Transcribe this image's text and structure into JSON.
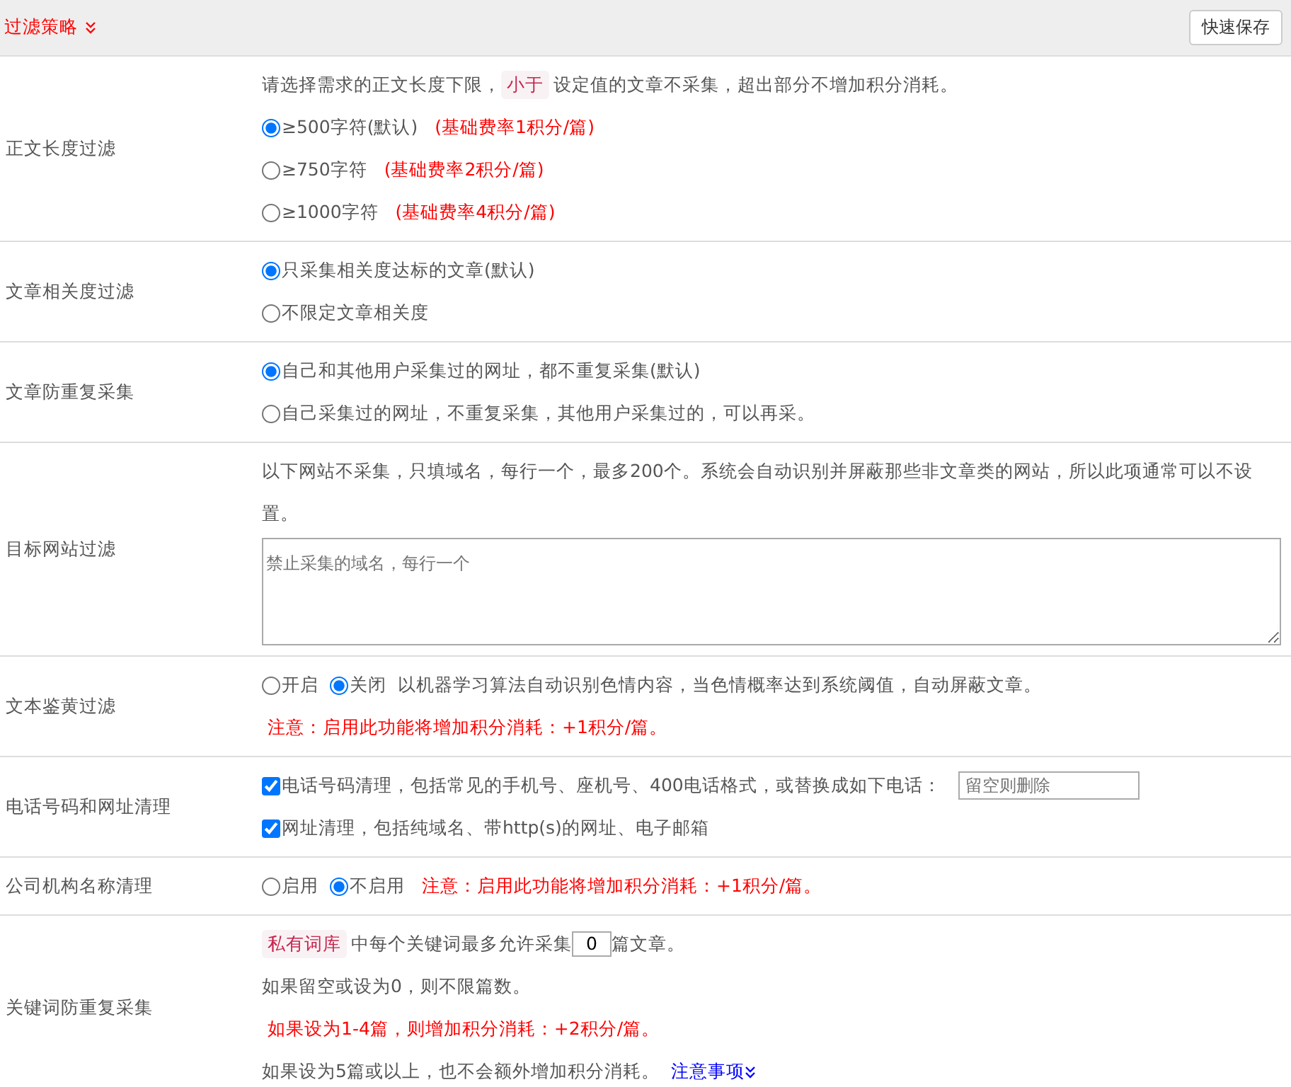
{
  "header": {
    "title": "过滤策略",
    "save_button": "快速保存"
  },
  "rows": [
    {
      "label": "正文长度过滤",
      "lines": [
        [
          {
            "kind": "text",
            "text": "请选择需求的正文长度下限，"
          },
          {
            "kind": "tag",
            "text": "小于"
          },
          {
            "kind": "text",
            "text": "设定值的文章不采集，超出部分不增加积分消耗。"
          }
        ],
        [
          {
            "kind": "radio",
            "text": "≥500字符(默认)",
            "selected": true
          },
          {
            "kind": "note",
            "text": "(基础费率1积分/篇)"
          }
        ],
        [
          {
            "kind": "radio",
            "text": "≥750字符",
            "selected": false
          },
          {
            "kind": "note",
            "text": "(基础费率2积分/篇)"
          }
        ],
        [
          {
            "kind": "radio",
            "text": "≥1000字符",
            "selected": false
          },
          {
            "kind": "note",
            "text": "(基础费率4积分/篇)"
          }
        ]
      ]
    },
    {
      "label": "文章相关度过滤",
      "lines": [
        [
          {
            "kind": "radio",
            "text": "只采集相关度达标的文章(默认)",
            "selected": true
          }
        ],
        [
          {
            "kind": "radio",
            "text": "不限定文章相关度",
            "selected": false
          }
        ]
      ]
    },
    {
      "label": "文章防重复采集",
      "lines": [
        [
          {
            "kind": "radio",
            "text": "自己和其他用户采集过的网址，都不重复采集(默认)",
            "selected": true
          }
        ],
        [
          {
            "kind": "radio",
            "text": "自己采集过的网址，不重复采集，其他用户采集过的，可以再采。",
            "selected": false
          }
        ]
      ]
    },
    {
      "label": "目标网站过滤",
      "lines": [
        [
          {
            "kind": "text",
            "text": "以下网站不采集，只填域名，每行一个，最多200个。系统会自动识别并屏蔽那些非文章类的网站，所以此项通常可以不设置。"
          }
        ],
        [
          {
            "kind": "textarea",
            "placeholder": "禁止采集的域名，每行一个"
          }
        ]
      ]
    },
    {
      "label": "文本鉴黄过滤",
      "lines": [
        [
          {
            "kind": "radio",
            "text": "开启",
            "selected": false
          },
          {
            "kind": "radio",
            "text": "关闭",
            "selected": true
          },
          {
            "kind": "text",
            "text": "以机器学习算法自动识别色情内容，当色情概率达到系统阈值，自动屏蔽文章。"
          }
        ],
        [
          {
            "kind": "note",
            "text": "注意：启用此功能将增加积分消耗：+1积分/篇。"
          }
        ]
      ]
    },
    {
      "label": "电话号码和网址清理",
      "lines": [
        [
          {
            "kind": "checkbox",
            "text": "电话号码清理，包括常见的手机号、座机号、400电话格式，或替换成如下电话：",
            "checked": true
          },
          {
            "kind": "input",
            "placeholder": "留空则删除"
          }
        ],
        [
          {
            "kind": "checkbox",
            "text": "网址清理，包括纯域名、带http(s)的网址、电子邮箱",
            "checked": true
          }
        ]
      ]
    },
    {
      "label": "公司机构名称清理",
      "lines": [
        [
          {
            "kind": "radio",
            "text": "启用",
            "selected": false
          },
          {
            "kind": "radio",
            "text": "不启用",
            "selected": true
          },
          {
            "kind": "note",
            "text": "注意：启用此功能将增加积分消耗：+1积分/篇。"
          }
        ]
      ]
    },
    {
      "label": "关键词防重复采集",
      "lines": [
        [
          {
            "kind": "tag",
            "text": "私有词库"
          },
          {
            "kind": "text",
            "text": "中每个关键词最多允许采集"
          },
          {
            "kind": "number",
            "value": "0"
          },
          {
            "kind": "text",
            "text": "篇文章。"
          }
        ],
        [
          {
            "kind": "text",
            "text": "如果留空或设为0，则不限篇数。"
          }
        ],
        [
          {
            "kind": "note",
            "text": "如果设为1-4篇，则增加积分消耗：+2积分/篇。"
          }
        ],
        [
          {
            "kind": "text",
            "text": "如果设为5篇或以上，也不会额外增加积分消耗。"
          },
          {
            "kind": "link",
            "text": "注意事项"
          }
        ]
      ]
    }
  ]
}
